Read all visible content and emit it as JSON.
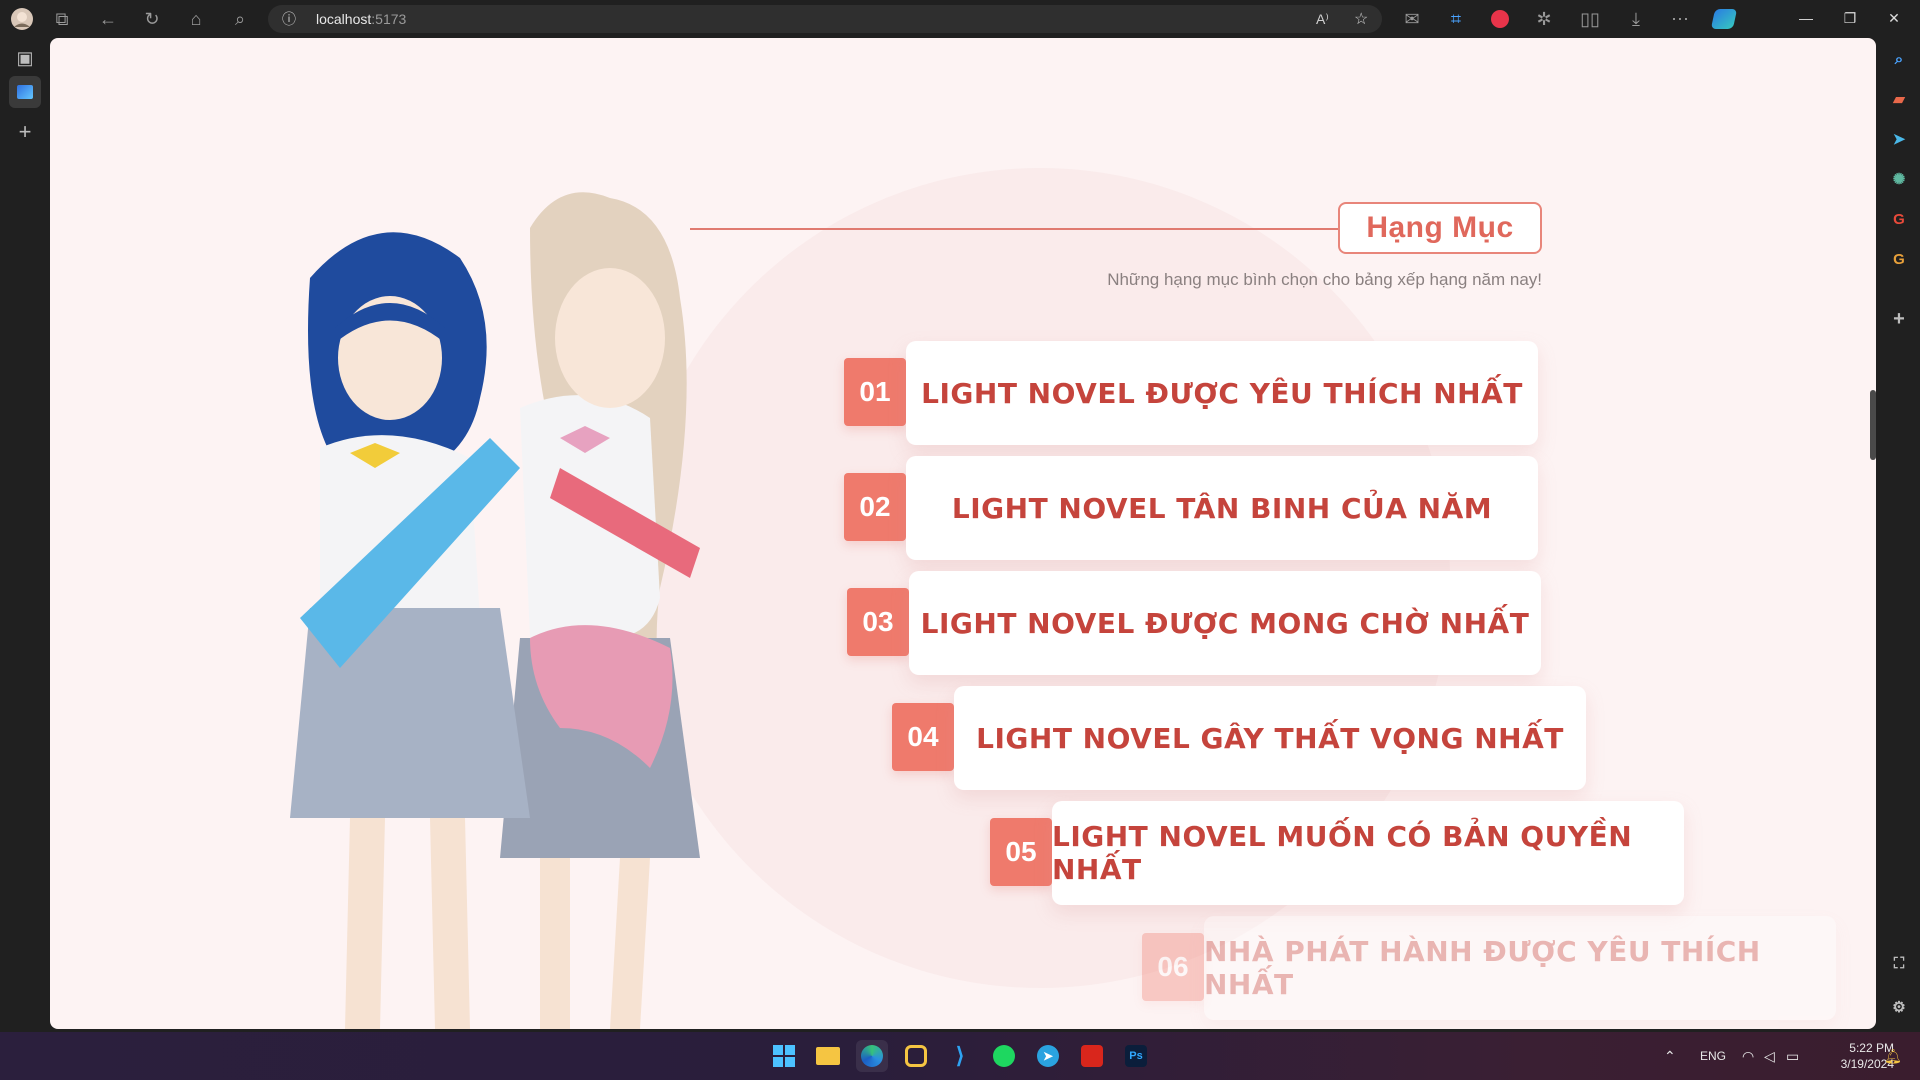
{
  "browser": {
    "url_host": "localhost",
    "url_port": ":5173"
  },
  "section": {
    "title": "Hạng Mục",
    "subtitle": "Những hạng mục bình chọn cho bảng xếp hạng năm nay!"
  },
  "categories": [
    {
      "num": "01",
      "label": "LIGHT NOVEL ĐƯỢC YÊU THÍCH NHẤT"
    },
    {
      "num": "02",
      "label": "LIGHT NOVEL TÂN BINH CỦA NĂM"
    },
    {
      "num": "03",
      "label": "LIGHT NOVEL ĐƯỢC MONG CHỜ NHẤT"
    },
    {
      "num": "04",
      "label": "LIGHT NOVEL GÂY THẤT VỌNG NHẤT"
    },
    {
      "num": "05",
      "label": "LIGHT NOVEL MUỐN CÓ BẢN QUYỀN NHẤT"
    },
    {
      "num": "06",
      "label": "NHÀ PHÁT HÀNH ĐƯỢC YÊU THÍCH NHẤT"
    }
  ],
  "taskbar": {
    "lang": "ENG",
    "time": "5:22 PM",
    "date": "3/19/2024",
    "photoshop_label": "Ps"
  },
  "colors": {
    "accent": "#ef7a6c",
    "card_text": "#c5443c",
    "page_bg": "#fdf3f3"
  }
}
